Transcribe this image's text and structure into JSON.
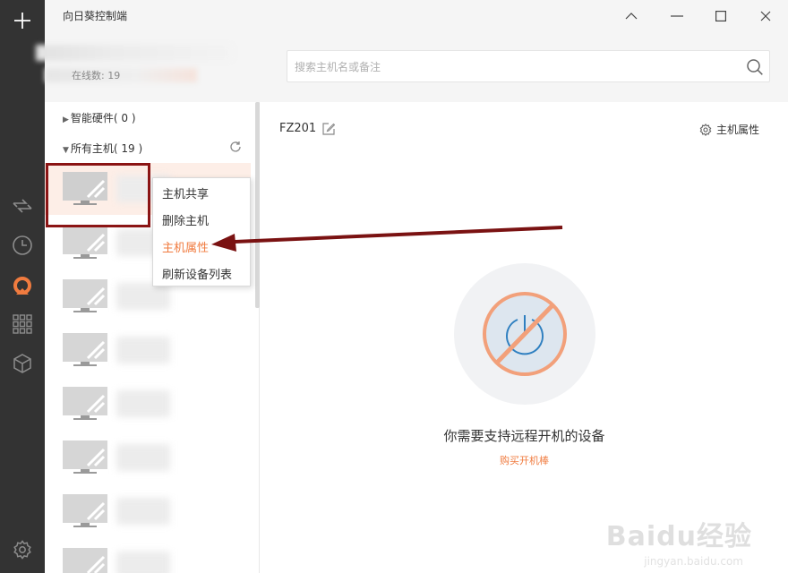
{
  "window": {
    "title": "向日葵控制端"
  },
  "account": {
    "blurred_text": "在线数: 19"
  },
  "search": {
    "placeholder": "搜索主机名或备注"
  },
  "groups": [
    {
      "label": "智能硬件( 0 )",
      "expanded": false
    },
    {
      "label": "所有主机( 19 )",
      "expanded": true
    }
  ],
  "context_menu": {
    "items": [
      "主机共享",
      "删除主机",
      "主机属性",
      "刷新设备列表"
    ],
    "active_index": 2
  },
  "detail": {
    "host_name": "FZ201",
    "properties_label": "主机属性",
    "empty_message": "你需要支持远程开机的设备",
    "buy_link": "购买开机棒"
  },
  "watermark": {
    "brand": "Baidu经验",
    "url": "jingyan.baidu.com"
  },
  "colors": {
    "accent": "#f07b3f",
    "rail": "#333333",
    "highlight_box": "#8b1414"
  },
  "icons": {
    "rail": [
      "plus-icon",
      "remote-control-icon",
      "history-icon",
      "sunlogin-logo-icon",
      "apps-icon",
      "cube-icon",
      "settings-icon"
    ]
  }
}
